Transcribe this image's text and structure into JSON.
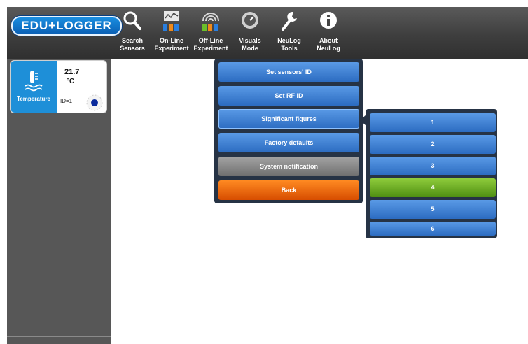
{
  "app": {
    "logo_text": "EDU+LOGGER"
  },
  "toolbar": {
    "items": [
      {
        "label": "Search\nSensors",
        "icon": "search-icon"
      },
      {
        "label": "On-Line\nExperiment",
        "icon": "online-experiment-icon"
      },
      {
        "label": "Off-Line\nExperiment",
        "icon": "offline-experiment-icon"
      },
      {
        "label": "Visuals\nMode",
        "icon": "visuals-mode-icon"
      },
      {
        "label": "NeuLog\nTools",
        "icon": "wrench-icon"
      },
      {
        "label": "About\nNeuLog",
        "icon": "info-icon"
      }
    ]
  },
  "sensor": {
    "value": "21.7",
    "unit": "°C",
    "label": "Temperature",
    "id_text": "ID=1",
    "icon": "thermometer-icon",
    "status_icon": "sensor-status-icon"
  },
  "tools_menu": {
    "items": [
      "Set sensors' ID",
      "Set RF ID",
      "Significant figures",
      "Factory defaults",
      "System notification",
      "Back"
    ]
  },
  "significant_figures_menu": {
    "options": [
      "1",
      "2",
      "3",
      "4",
      "5",
      "6"
    ],
    "selected": "4"
  },
  "colors": {
    "toolbar": "#3e3e3e",
    "sidebar": "#575757",
    "menu_bg": "#263345",
    "button_blue": "#3a7bd0",
    "button_gray": "#8a8a8a",
    "button_orange": "#f06a10",
    "selected_green": "#6aa829",
    "sensor_blue": "#1e8fd8"
  }
}
